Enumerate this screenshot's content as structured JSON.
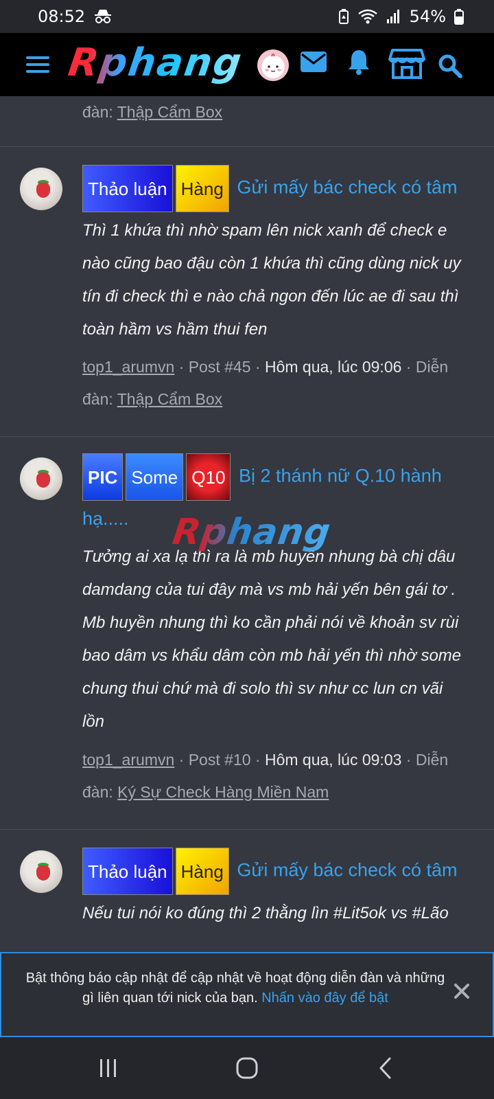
{
  "status_bar": {
    "time": "08:52",
    "battery": "54%",
    "icons": [
      "incognito-icon",
      "battery-saver-icon",
      "wifi-icon",
      "signal-icon",
      "battery-icon"
    ]
  },
  "header": {
    "logo": "Rphang",
    "icons": [
      "menu-icon",
      "user-avatar",
      "mail-icon",
      "bell-icon",
      "store-icon",
      "search-icon"
    ]
  },
  "colors": {
    "background": "#353840",
    "header_bg": "#000000",
    "accent": "#3aa2ec",
    "text": "#f2f2f2",
    "muted": "#a7aab0"
  },
  "top_partial": {
    "forum_prefix": "đàn:",
    "forum": "Thập Cẩm Box"
  },
  "posts": [
    {
      "tags": [
        "Thảo luận",
        "Hàng"
      ],
      "title": "Gửi mấy bác check có tâm",
      "snippet": [
        "Thì 1 khứa thì nhờ spam lên nick xanh để check e",
        "nào cũng bao đậu còn 1 khứa thì cũng dùng nick uy",
        "tín đi check thì e nào chả ngon đến lúc ae đi sau thì",
        "toàn hầm vs hầm thui fen"
      ],
      "author": "top1_arumvn",
      "post_no": "Post #45",
      "time": "Hôm qua, lúc 09:06",
      "forum_prefix": "Diễn",
      "forum_prefix2": "đàn:",
      "forum": "Thập Cẩm Box"
    },
    {
      "tags": [
        "PIC",
        "Some",
        "Q10"
      ],
      "title_line1": "Bị 2 thánh nữ Q.10 hành",
      "title_line2": "hạ.....",
      "snippet": [
        "Tưởng ai xa lạ thì ra là mb huyền nhung bà chị dâu",
        "damdang của tui đây mà vs mb hải yến bên gái tơ .",
        "Mb huyền nhung thì ko cần phải nói về khoản sv rùi",
        "bao dâm vs khẩu dâm còn mb hải yến thì nhờ some",
        "chung thui chứ mà đi solo thì sv như cc lun cn vãi",
        "lồn"
      ],
      "author": "top1_arumvn",
      "post_no": "Post #10",
      "time": "Hôm qua, lúc 09:03",
      "forum_prefix": "Diễn",
      "forum_prefix2": "đàn:",
      "forum": "Ký Sự Check Hàng Miền Nam"
    },
    {
      "tags": [
        "Thảo luận",
        "Hàng"
      ],
      "title": "Gửi mấy bác check có tâm",
      "snippet": [
        "Nếu tui nói ko đúng thì 2 thằng lìn #Lit5ok vs #Lão"
      ]
    }
  ],
  "watermark": "Rphang",
  "notification": {
    "text": "Bật thông báo cập nhật để cập nhật về hoạt động diễn đàn và những gì liên quan tới nick của bạn.",
    "link": "Nhấn vào đây để bật"
  },
  "system_nav": [
    "recents-icon",
    "home-icon",
    "back-icon"
  ]
}
